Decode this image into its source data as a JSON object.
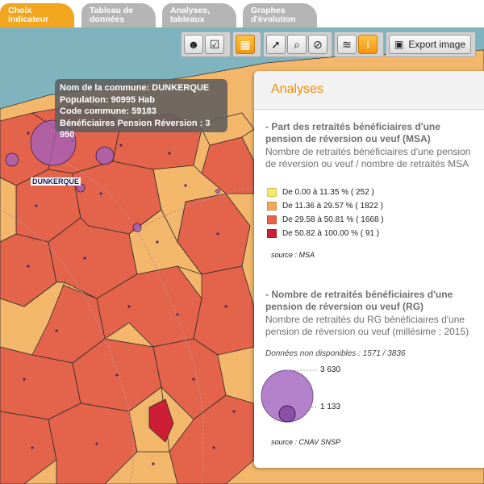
{
  "tabs": [
    {
      "line1": "Choix",
      "line2": "indicateur",
      "active": true
    },
    {
      "line1": "Tableau de",
      "line2": "données",
      "active": false
    },
    {
      "line1": "Analyses,",
      "line2": "tableaux",
      "active": false
    },
    {
      "line1": "Graphes",
      "line2": "d'évolution",
      "active": false
    }
  ],
  "toolbar": {
    "export_label": "Export image"
  },
  "tooltip": {
    "commune": "Nom de la commune: DUNKERQUE",
    "population": "Population: 90995 Hab",
    "code": "Code commune: 59183",
    "beneficiaires": "Bénéficiaires Pension Réversion : 3 950"
  },
  "map_label": "DUNKERQUE",
  "panel": {
    "title": "Analyses",
    "section1": {
      "title": "- Part des retraités bénéficiaires d'une pension de réversion ou veuf (MSA)",
      "subtitle": "Nombre de retraités bénéficiaires d'une pension de réversion ou veuf / nombre de retraités MSA",
      "legend": [
        {
          "label": "De 0.00 à 11.35 % ( 252 )",
          "color": "#f7e86a"
        },
        {
          "label": "De 11.36 à 29.57 % ( 1822 )",
          "color": "#f2a85a"
        },
        {
          "label": "De 29.58 à 50.81 % ( 1668 )",
          "color": "#e4644b"
        },
        {
          "label": "De 50.82 à 100.00 % ( 91 )",
          "color": "#cc1f35"
        }
      ],
      "source": "source : MSA"
    },
    "section2": {
      "title": "- Nombre de retraités bénéficiaires d'une pension de réversion ou veuf (RG)",
      "subtitle": "Nombre de retraités du RG bénéficiaires d'une pension de réversion ou veuf (millésime : 2015)",
      "nodata": "Données non disponibles : 1571 / 3836",
      "max_value": "3 630",
      "min_value": "1 133",
      "circle_color": "#a46bc0",
      "source": "source : CNAV SNSP"
    }
  },
  "colors": {
    "accent": "#f2a51f",
    "class_light": "#f2b76a",
    "class_mid": "#e4644b",
    "class_dark": "#cc1f35",
    "symbol": "#a060c0"
  }
}
